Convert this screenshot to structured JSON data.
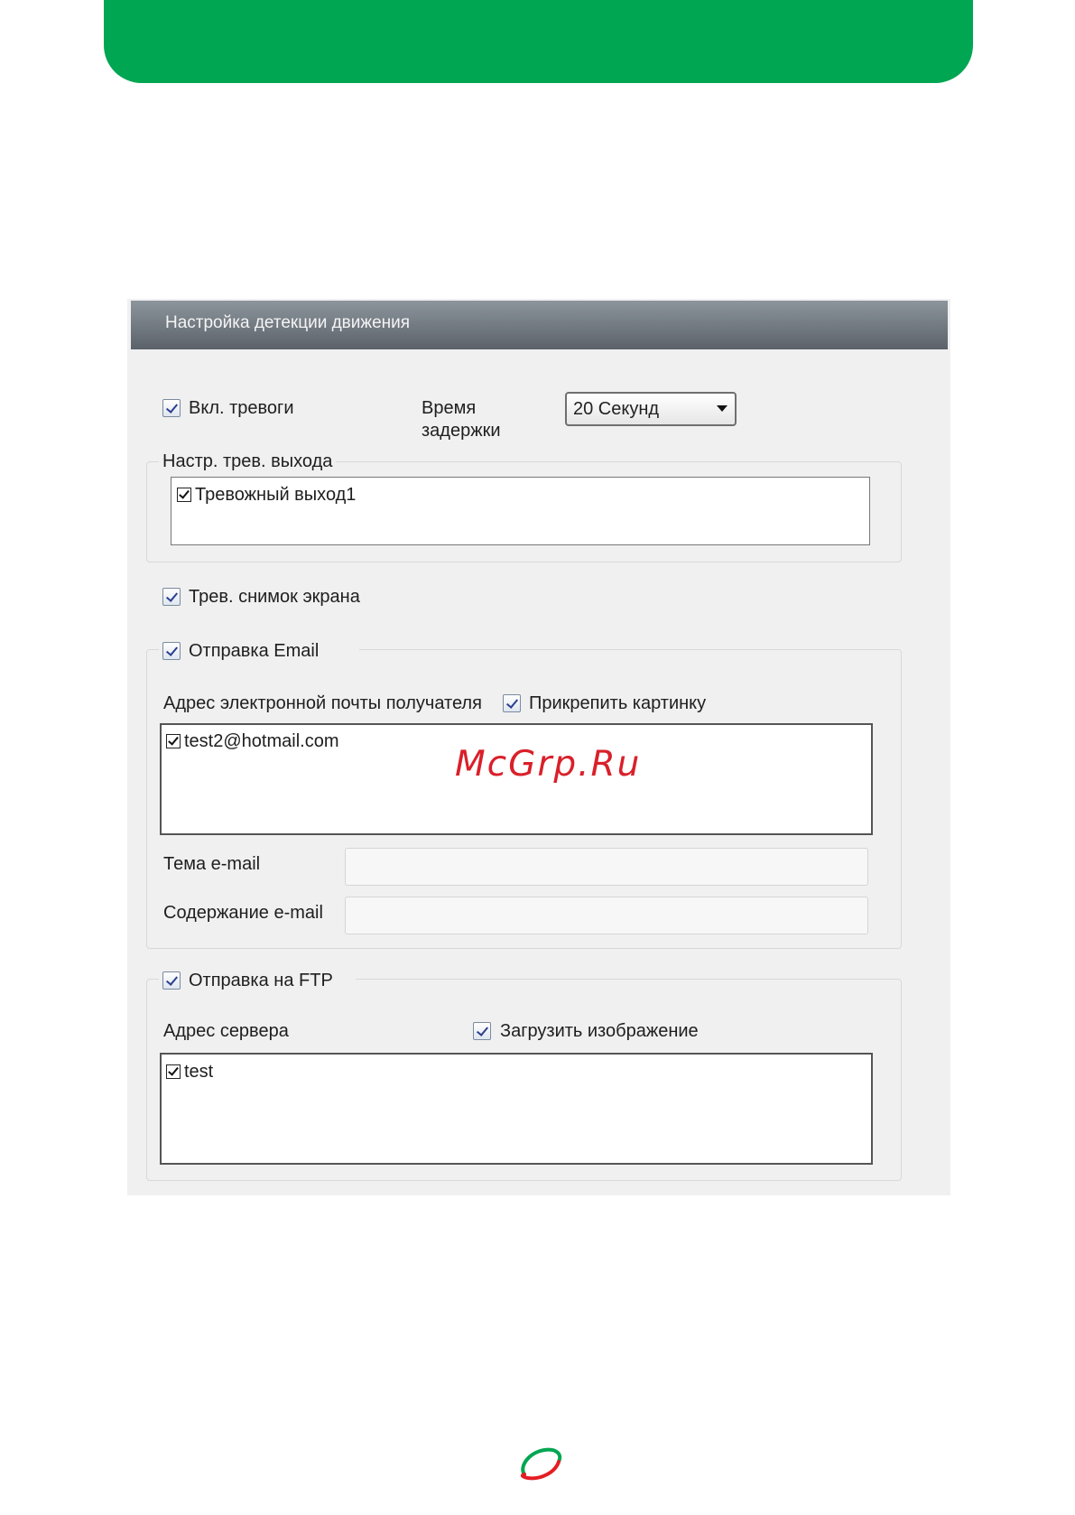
{
  "dialog": {
    "title": "Настройка детекции движения",
    "alarm_enable": {
      "label": "Вкл. тревоги",
      "checked": true
    },
    "delay": {
      "label_line1": "Время",
      "label_line2": "задержки",
      "selected": "20 Секунд"
    },
    "alarm_output": {
      "group_label": "Настр. трев. выхода",
      "items": [
        {
          "label": "Тревожный выход1",
          "checked": true
        }
      ]
    },
    "snapshot": {
      "label": "Трев. снимок экрана",
      "checked": true
    },
    "email": {
      "label": "Отправка Email",
      "checked": true,
      "recipient_label": "Адрес электронной почты получателя",
      "attach": {
        "label": "Прикрепить картинку",
        "checked": true
      },
      "recipients": [
        {
          "label": "test2@hotmail.com",
          "checked": true
        }
      ],
      "subject_label": "Тема e-mail",
      "subject_value": "",
      "body_label": "Содержание e-mail",
      "body_value": ""
    },
    "ftp": {
      "label": "Отправка на FTP",
      "checked": true,
      "server_label": "Адрес сервера",
      "upload": {
        "label": "Загрузить изображение",
        "checked": true
      },
      "servers": [
        {
          "label": "test",
          "checked": true
        }
      ]
    }
  },
  "watermark": "McGrp.Ru",
  "colors": {
    "banner": "#00a651",
    "title_bar": "#6b737b",
    "logo_green": "#00a651",
    "logo_red": "#e31e24"
  }
}
